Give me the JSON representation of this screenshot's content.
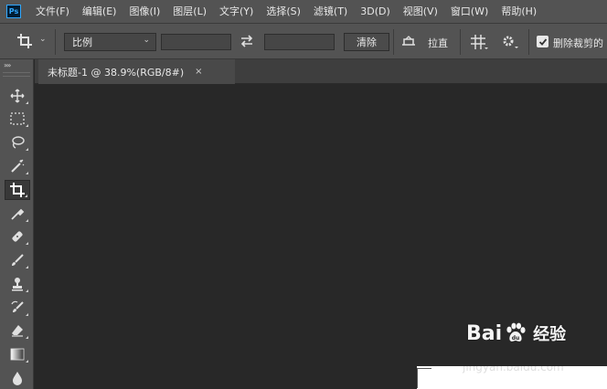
{
  "app": {
    "logo_text": "Ps"
  },
  "menu": [
    "文件(F)",
    "编辑(E)",
    "图像(I)",
    "图层(L)",
    "文字(Y)",
    "选择(S)",
    "滤镜(T)",
    "3D(D)",
    "视图(V)",
    "窗口(W)",
    "帮助(H)"
  ],
  "options_bar": {
    "ratio_select": "比例",
    "width_value": "",
    "height_value": "",
    "clear_label": "清除",
    "straighten_label": "拉直",
    "delete_cropped_checked": true,
    "delete_cropped_label": "删除裁剪的"
  },
  "tools": [
    {
      "name": "move-tool",
      "icon": "move-icon",
      "active": false
    },
    {
      "name": "marquee-tool",
      "icon": "marquee-icon",
      "active": false
    },
    {
      "name": "lasso-tool",
      "icon": "lasso-icon",
      "active": false
    },
    {
      "name": "magic-wand-tool",
      "icon": "magic-wand-icon",
      "active": false
    },
    {
      "name": "crop-tool",
      "icon": "crop-icon",
      "active": true
    },
    {
      "name": "eyedropper-tool",
      "icon": "eyedropper-icon",
      "active": false
    },
    {
      "name": "healing-brush-tool",
      "icon": "bandage-icon",
      "active": false
    },
    {
      "name": "brush-tool",
      "icon": "brush-icon",
      "active": false
    },
    {
      "name": "clone-stamp-tool",
      "icon": "stamp-icon",
      "active": false
    },
    {
      "name": "history-brush-tool",
      "icon": "history-brush-icon",
      "active": false
    },
    {
      "name": "eraser-tool",
      "icon": "eraser-icon",
      "active": false
    },
    {
      "name": "gradient-tool",
      "icon": "gradient-icon",
      "active": false
    },
    {
      "name": "blur-tool",
      "icon": "drop-icon",
      "active": false
    }
  ],
  "document_tab": {
    "title": "未标题-1 @ 38.9%(RGB/8#)",
    "close": "×"
  },
  "watermark": {
    "brand": "Bai",
    "brand2": "du",
    "suffix": "经验",
    "url": "jingyan.baidu.com"
  },
  "colors": {
    "ui_panel": "#535353",
    "canvas": "#282828",
    "text": "#e8e8e8",
    "accent": "#31a8ff"
  }
}
